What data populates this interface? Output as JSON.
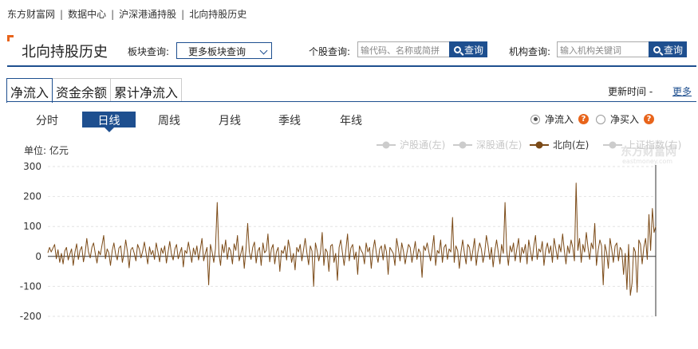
{
  "breadcrumb": [
    "东方财富网",
    "数据中心",
    "沪深港通持股",
    "北向持股历史"
  ],
  "header": {
    "title": "北向持股历史",
    "sector_label": "板块查询:",
    "sector_select": "更多板块查询",
    "stock_label": "个股查询:",
    "stock_placeholder": "输代码、名称或简拼",
    "stock_button": "查询",
    "org_label": "机构查询:",
    "org_placeholder": "输入机构关键词",
    "org_button": "查询"
  },
  "tabs": [
    "净流入",
    "资金余额",
    "累计净流入"
  ],
  "update_time": "更新时间 -",
  "more": "更多",
  "periods": [
    "分时",
    "日线",
    "周线",
    "月线",
    "季线",
    "年线"
  ],
  "active_period": "日线",
  "radios": [
    {
      "label": "净流入",
      "checked": true
    },
    {
      "label": "净买入",
      "checked": false
    }
  ],
  "help_glyph": "?",
  "unit": "单位: 亿元",
  "watermark": {
    "cn": "东方财富网",
    "en": "eastmoney.com"
  },
  "colors": {
    "brand": "#1e4f8f",
    "accent": "#e8641b",
    "series": "#7b4a17",
    "inactive": "#cccccc"
  },
  "chart_data": {
    "type": "line",
    "ylim": [
      -200,
      300
    ],
    "yticks": [
      "300",
      "200",
      "100",
      "0",
      "-100",
      "-200"
    ],
    "legend": [
      {
        "name": "沪股通(左)",
        "active": false
      },
      {
        "name": "深股通(左)",
        "active": false
      },
      {
        "name": "北向(左)",
        "active": true
      },
      {
        "name": "上证指数(右)",
        "active": false
      }
    ],
    "series": [
      {
        "name": "北向(左)",
        "values": [
          12,
          30,
          15,
          28,
          40,
          -8,
          22,
          -20,
          10,
          -25,
          18,
          30,
          -12,
          8,
          25,
          -30,
          15,
          42,
          -10,
          20,
          33,
          -18,
          12,
          60,
          15,
          -5,
          30,
          45,
          10,
          -22,
          18,
          5,
          38,
          70,
          -8,
          25,
          12,
          -30,
          20,
          45,
          8,
          -12,
          28,
          35,
          -20,
          10,
          55,
          15,
          -38,
          22,
          30,
          10,
          -15,
          40,
          25,
          -5,
          18,
          48,
          12,
          -25,
          32,
          6,
          20,
          -10,
          45,
          15,
          -18,
          28,
          10,
          35,
          -22,
          15,
          50,
          8,
          -12,
          25,
          40,
          -8,
          12,
          30,
          -35,
          20,
          10,
          48,
          15,
          -20,
          28,
          5,
          35,
          -12,
          22,
          60,
          -15,
          10,
          30,
          -95,
          40,
          15,
          -20,
          25,
          180,
          10,
          -30,
          40,
          12,
          55,
          -10,
          30,
          18,
          -25,
          42,
          20,
          70,
          -15,
          10,
          35,
          -40,
          22,
          110,
          15,
          -10,
          30,
          48,
          -22,
          18,
          30,
          -30,
          45,
          12,
          20,
          75,
          -18,
          25,
          40,
          -25,
          15,
          30,
          -50,
          20,
          10,
          35,
          -12,
          55,
          25,
          -20,
          10,
          -45,
          30,
          15,
          40,
          -15,
          22,
          60,
          10,
          -28,
          35,
          18,
          -100,
          45,
          20,
          -15,
          12,
          80,
          -30,
          25,
          15,
          -50,
          35,
          40,
          -20,
          10,
          -80,
          30,
          55,
          12,
          -30,
          22,
          75,
          -15,
          28,
          40,
          -10,
          15,
          -60,
          35,
          20,
          10,
          -25,
          45,
          15,
          30,
          -40,
          20,
          55,
          10,
          -20,
          25,
          35,
          -12,
          40,
          15,
          -60,
          30,
          20,
          10,
          -30,
          60,
          25,
          -15,
          45,
          18,
          -25,
          10,
          40,
          30,
          -20,
          15,
          50,
          -10,
          25,
          12,
          -70,
          35,
          20,
          45,
          15,
          -15,
          25,
          70,
          -30,
          20,
          10,
          55,
          -20,
          30,
          40,
          -10,
          25,
          15,
          130,
          -20,
          35,
          20,
          -40,
          15,
          55,
          10,
          -25,
          40,
          30,
          -15,
          20,
          60,
          -30,
          15,
          45,
          25,
          -20,
          10,
          70,
          35,
          -10,
          30,
          -35,
          20,
          55,
          15,
          -25,
          40,
          10,
          180,
          20,
          -30,
          35,
          15,
          45,
          -15,
          25,
          60,
          -20,
          30,
          10,
          40,
          -25,
          55,
          20,
          -15,
          35,
          70,
          -10,
          25,
          15,
          50,
          -30,
          20,
          45,
          10,
          35,
          -20,
          60,
          25,
          -10,
          40,
          15,
          75,
          20,
          -25,
          35,
          10,
          55,
          30,
          -15,
          245,
          20,
          60,
          -20,
          40,
          15,
          80,
          30,
          -10,
          45,
          25,
          110,
          -30,
          20,
          55,
          35,
          -95,
          40,
          15,
          -40,
          60,
          25,
          -20,
          35,
          45,
          -15,
          30,
          20,
          -60,
          10,
          -110,
          40,
          -130,
          -90,
          30,
          15,
          -120,
          55,
          40,
          -25,
          30,
          60,
          -10,
          140,
          20,
          160,
          80,
          100
        ]
      }
    ]
  }
}
